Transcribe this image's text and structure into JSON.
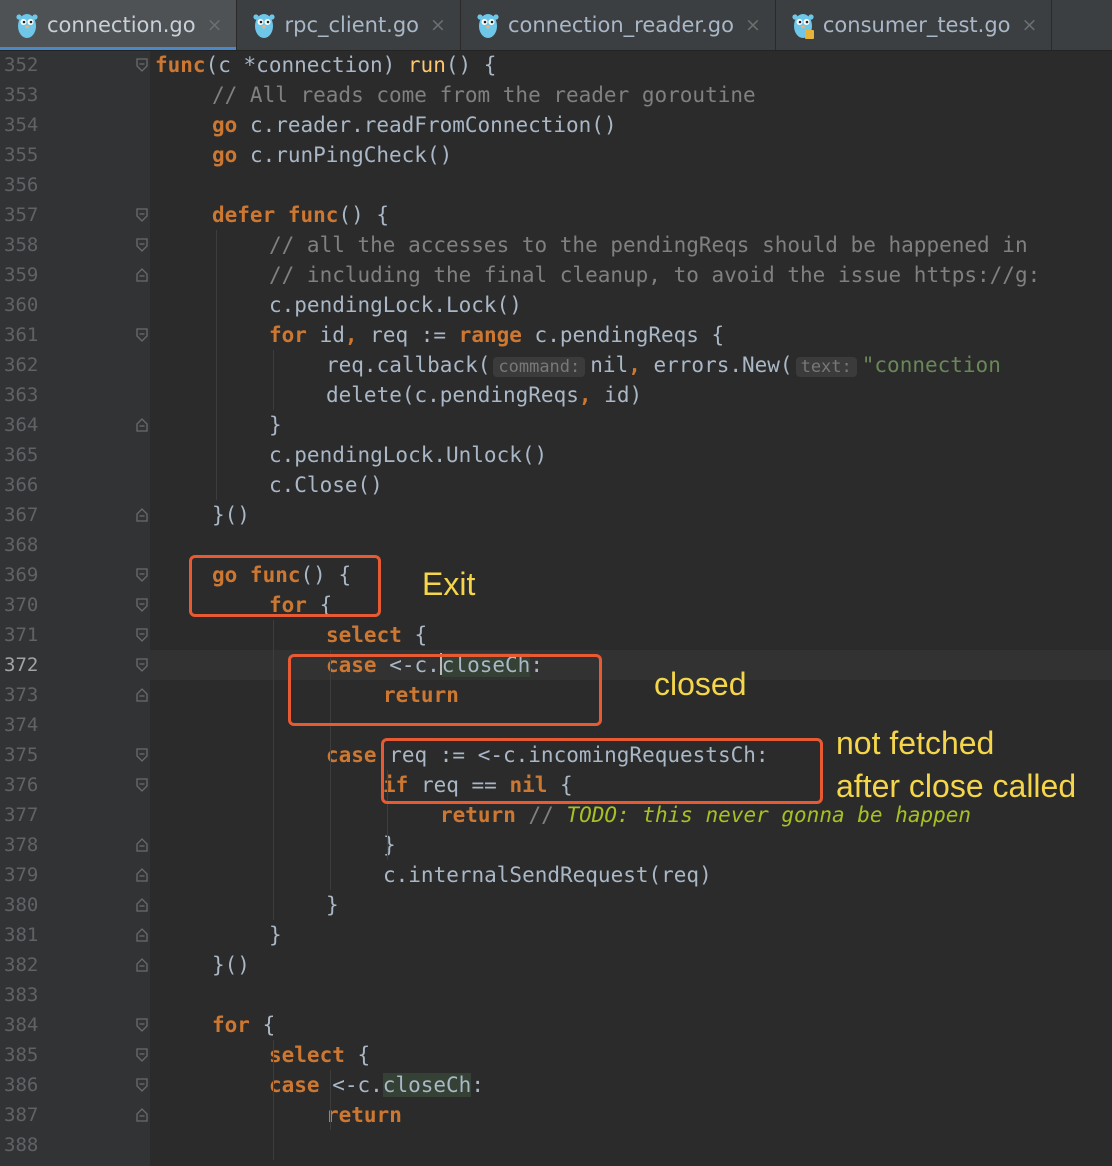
{
  "tabs": [
    {
      "label": "connection.go",
      "active": true,
      "icon": "gopher-icon"
    },
    {
      "label": "rpc_client.go",
      "active": false,
      "icon": "gopher-icon"
    },
    {
      "label": "connection_reader.go",
      "active": false,
      "icon": "gopher-icon"
    },
    {
      "label": "consumer_test.go",
      "active": false,
      "icon": "gopher-test-icon"
    }
  ],
  "tab_close_glyph": "×",
  "current_line": 372,
  "lines": [
    {
      "n": 352,
      "indent": 0,
      "fold": "open",
      "tokens": [
        [
          "kw",
          "func"
        ],
        [
          "",
          "("
        ],
        [
          "",
          "c "
        ],
        [
          "",
          "*connection"
        ],
        [
          "",
          ") "
        ],
        [
          "fn",
          "run"
        ],
        [
          "",
          "() {"
        ]
      ]
    },
    {
      "n": 353,
      "indent": 1,
      "tokens": [
        [
          "cm",
          "// All reads come from the reader goroutine"
        ]
      ]
    },
    {
      "n": 354,
      "indent": 1,
      "tokens": [
        [
          "kw",
          "go "
        ],
        [
          "",
          "c.reader.readFromConnection()"
        ]
      ]
    },
    {
      "n": 355,
      "indent": 1,
      "tokens": [
        [
          "kw",
          "go "
        ],
        [
          "",
          "c.runPingCheck()"
        ]
      ]
    },
    {
      "n": 356,
      "indent": 0,
      "tokens": []
    },
    {
      "n": 357,
      "indent": 1,
      "fold": "open",
      "tokens": [
        [
          "kw",
          "defer func"
        ],
        [
          "",
          "() {"
        ]
      ]
    },
    {
      "n": 358,
      "indent": 2,
      "fold": "open",
      "tokens": [
        [
          "cm",
          "// all the accesses to the pendingReqs should be happened in"
        ]
      ]
    },
    {
      "n": 359,
      "indent": 2,
      "fold": "end",
      "tokens": [
        [
          "cm",
          "// including the final cleanup, to avoid the issue https://g:"
        ]
      ]
    },
    {
      "n": 360,
      "indent": 2,
      "tokens": [
        [
          "",
          "c.pendingLock.Lock()"
        ]
      ]
    },
    {
      "n": 361,
      "indent": 2,
      "fold": "open",
      "tokens": [
        [
          "kw",
          "for "
        ],
        [
          "",
          "id"
        ],
        [
          "kw",
          ", "
        ],
        [
          "",
          "req := "
        ],
        [
          "kw",
          "range "
        ],
        [
          "",
          "c.pendingReqs {"
        ]
      ]
    },
    {
      "n": 362,
      "indent": 3,
      "tokens": [
        [
          "",
          "req.callback("
        ],
        [
          "hint",
          "command:"
        ],
        [
          "",
          "nil"
        ],
        [
          "kw",
          ", "
        ],
        [
          "",
          "errors.New("
        ],
        [
          "hint",
          "text:"
        ],
        [
          "str",
          "\"connection"
        ]
      ]
    },
    {
      "n": 363,
      "indent": 3,
      "tokens": [
        [
          "",
          "delete(c.pendingReqs"
        ],
        [
          "kw",
          ", "
        ],
        [
          "",
          "id)"
        ]
      ]
    },
    {
      "n": 364,
      "indent": 2,
      "fold": "end",
      "tokens": [
        [
          "",
          "}"
        ]
      ]
    },
    {
      "n": 365,
      "indent": 2,
      "tokens": [
        [
          "",
          "c.pendingLock.Unlock()"
        ]
      ]
    },
    {
      "n": 366,
      "indent": 2,
      "tokens": [
        [
          "",
          "c.Close()"
        ]
      ]
    },
    {
      "n": 367,
      "indent": 1,
      "fold": "end",
      "tokens": [
        [
          "",
          "}()"
        ]
      ]
    },
    {
      "n": 368,
      "indent": 0,
      "tokens": []
    },
    {
      "n": 369,
      "indent": 1,
      "fold": "open",
      "tokens": [
        [
          "kw",
          "go func"
        ],
        [
          "",
          "() {"
        ]
      ]
    },
    {
      "n": 370,
      "indent": 2,
      "fold": "open",
      "tokens": [
        [
          "kw",
          "for "
        ],
        [
          "",
          "{"
        ]
      ]
    },
    {
      "n": 371,
      "indent": 3,
      "fold": "open",
      "tokens": [
        [
          "kw",
          "select "
        ],
        [
          "",
          "{"
        ]
      ]
    },
    {
      "n": 372,
      "indent": 3,
      "fold": "open",
      "tokens": [
        [
          "kw",
          "case "
        ],
        [
          "",
          "<-c."
        ],
        [
          "caret",
          ""
        ],
        [
          "hl",
          "closeCh"
        ],
        [
          "",
          ":"
        ]
      ]
    },
    {
      "n": 373,
      "indent": 4,
      "fold": "end",
      "tokens": [
        [
          "kw",
          "return"
        ]
      ]
    },
    {
      "n": 374,
      "indent": 0,
      "tokens": []
    },
    {
      "n": 375,
      "indent": 3,
      "fold": "open",
      "tokens": [
        [
          "kw",
          "case "
        ],
        [
          "",
          "req := <-c.incomingRequestsCh:"
        ]
      ]
    },
    {
      "n": 376,
      "indent": 4,
      "fold": "open",
      "tokens": [
        [
          "kw",
          "if "
        ],
        [
          "",
          "req == "
        ],
        [
          "kw",
          "nil "
        ],
        [
          "",
          "{"
        ]
      ]
    },
    {
      "n": 377,
      "indent": 5,
      "tokens": [
        [
          "kw",
          "return "
        ],
        [
          "cm",
          "// "
        ],
        [
          "todo",
          "TODO: this never gonna be happen"
        ]
      ]
    },
    {
      "n": 378,
      "indent": 4,
      "fold": "end",
      "tokens": [
        [
          "",
          "}"
        ]
      ]
    },
    {
      "n": 379,
      "indent": 4,
      "fold": "end",
      "tokens": [
        [
          "",
          "c.internalSendRequest(req)"
        ]
      ]
    },
    {
      "n": 380,
      "indent": 3,
      "fold": "end",
      "tokens": [
        [
          "",
          "}"
        ]
      ]
    },
    {
      "n": 381,
      "indent": 2,
      "fold": "end",
      "tokens": [
        [
          "",
          "}"
        ]
      ]
    },
    {
      "n": 382,
      "indent": 1,
      "fold": "end",
      "tokens": [
        [
          "",
          "}()"
        ]
      ]
    },
    {
      "n": 383,
      "indent": 0,
      "tokens": []
    },
    {
      "n": 384,
      "indent": 1,
      "fold": "open",
      "tokens": [
        [
          "kw",
          "for "
        ],
        [
          "",
          "{"
        ]
      ]
    },
    {
      "n": 385,
      "indent": 2,
      "fold": "open",
      "tokens": [
        [
          "kw",
          "select "
        ],
        [
          "",
          "{"
        ]
      ]
    },
    {
      "n": 386,
      "indent": 2,
      "fold": "open",
      "tokens": [
        [
          "kw",
          "case "
        ],
        [
          "",
          "<-c."
        ],
        [
          "hl",
          "closeCh"
        ],
        [
          "",
          ":"
        ]
      ]
    },
    {
      "n": 387,
      "indent": 3,
      "fold": "end",
      "tokens": [
        [
          "kw",
          "return"
        ]
      ]
    },
    {
      "n": 388,
      "indent": 0,
      "tokens": []
    }
  ],
  "annotations": {
    "exit_label": "Exit",
    "closed_label": "closed",
    "not_fetched_line1": "not fetched",
    "not_fetched_line2": "after close called"
  },
  "colors": {
    "annotation_box": "#e85a32",
    "annotation_text": "#f5d64a",
    "keyword": "#cc7832",
    "function": "#ffc66d",
    "comment": "#808080",
    "string": "#6a8759",
    "todo": "#a8c023"
  }
}
